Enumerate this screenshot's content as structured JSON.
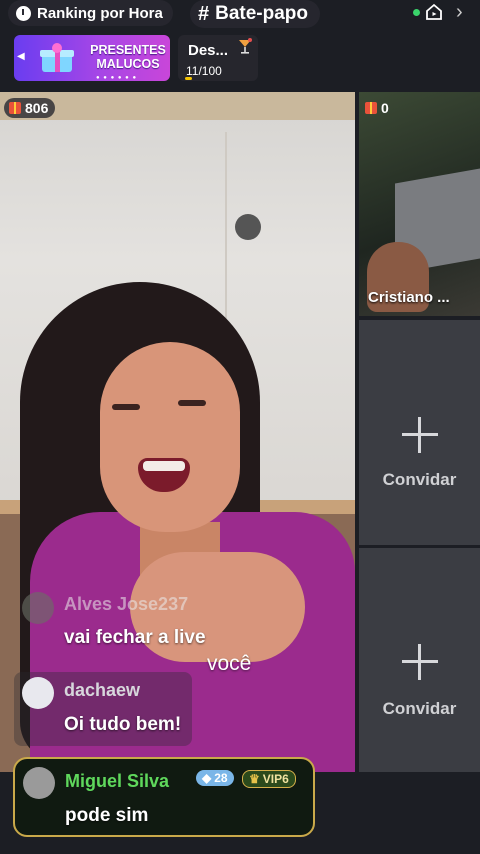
{
  "topbar": {
    "ranking_label": "Ranking por Hora",
    "chat_label": "Bate-papo",
    "chat_hash": "#"
  },
  "promo": {
    "title": "PRESENTES MALUCOS"
  },
  "task": {
    "title": "Des...",
    "progress_text": "11/100",
    "progress_value": 0.11
  },
  "main_video": {
    "gift_count": "806",
    "caption": "você"
  },
  "side_tiles": [
    {
      "gift_count": "0",
      "name": "Cristiano ..."
    },
    {
      "invite_label": "Convidar"
    },
    {
      "invite_label": "Convidar"
    }
  ],
  "chat": [
    {
      "user": "Alves Jose237",
      "text": "vai fechar a live"
    },
    {
      "user": "dachaew",
      "text": "Oi tudo bem!"
    },
    {
      "user": "Miguel Silva",
      "text": "pode sim",
      "level": "28",
      "vip": "VIP6"
    }
  ],
  "colors": {
    "vip_name": "#5fd85c",
    "gift_badge": "#e9523a",
    "promo_start": "#6a3df0",
    "promo_end": "#c946d9"
  }
}
